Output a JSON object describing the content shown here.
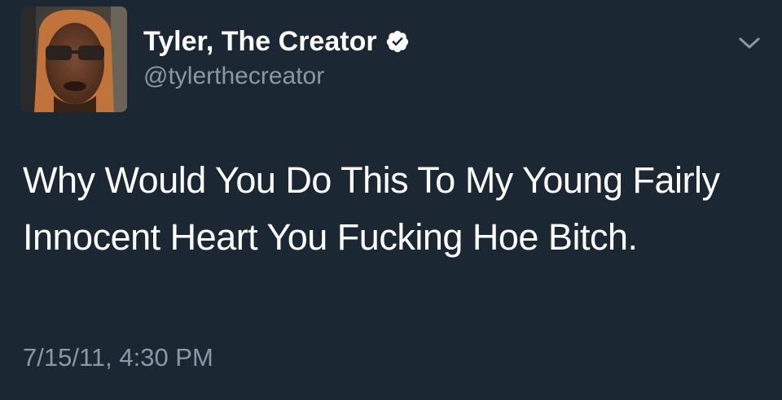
{
  "tweet": {
    "author": {
      "display_name": "Tyler, The Creator",
      "handle": "@tylerthecreator",
      "verified": true,
      "avatar_icon": "profile-photo"
    },
    "text": "Why Would You Do This To My Young Fairly Innocent Heart You Fucking Hoe Bitch.",
    "timestamp": "7/15/11, 4:30 PM",
    "menu_icon": "chevron-down-icon"
  },
  "colors": {
    "background": "#1c2734",
    "primary_text": "#ffffff",
    "secondary_text": "#8899a6",
    "verified_badge": "#ffffff"
  }
}
